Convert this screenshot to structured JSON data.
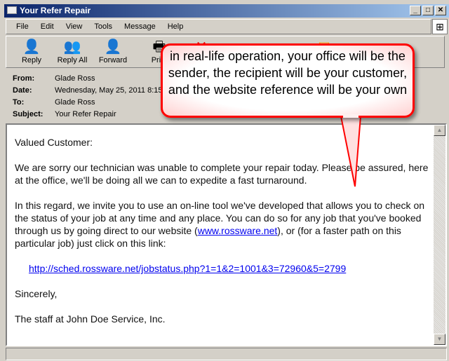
{
  "window": {
    "title": "Your Refer Repair",
    "controls": [
      "_",
      "□",
      "✕"
    ]
  },
  "menu": [
    "File",
    "Edit",
    "View",
    "Tools",
    "Message",
    "Help"
  ],
  "toolbar": [
    {
      "label": "Reply",
      "icon": "reply-icon"
    },
    {
      "label": "Reply All",
      "icon": "reply-all-icon"
    },
    {
      "label": "Forward",
      "icon": "forward-icon"
    },
    {
      "label": "Print",
      "icon": "print-icon"
    }
  ],
  "headers": {
    "from_label": "From:",
    "from": "Glade Ross",
    "date_label": "Date:",
    "date": "Wednesday, May 25, 2011 8:15",
    "to_label": "To:",
    "to": "Glade Ross",
    "subject_label": "Subject:",
    "subject": "Your Refer Repair"
  },
  "message": {
    "greeting": "Valued Customer:",
    "p1": "We are sorry our technician was unable to complete your repair today.  Please be assured, here at the office, we'll be doing all we can to expedite a fast turnaround.",
    "p2a": "In this regard, we invite you to use an on-line tool we've developed that allows you to check on the status of your job at any time and any place.  You can do so for any job that you've booked through us by going direct to our website (",
    "website": "www.rossware.net",
    "p2b": "), or (for a faster path on this particular job) just click on this link:",
    "link": "http://sched.rossware.net/jobstatus.php?1=1&2=1001&3=72960&5=2799",
    "closing": "Sincerely,",
    "signature": "The staff at John Doe Service, Inc."
  },
  "callout": {
    "text": "in real-life operation, your office will be the sender, the recipient will be your customer, and the website reference will be your own",
    "color": "#ff0000"
  }
}
